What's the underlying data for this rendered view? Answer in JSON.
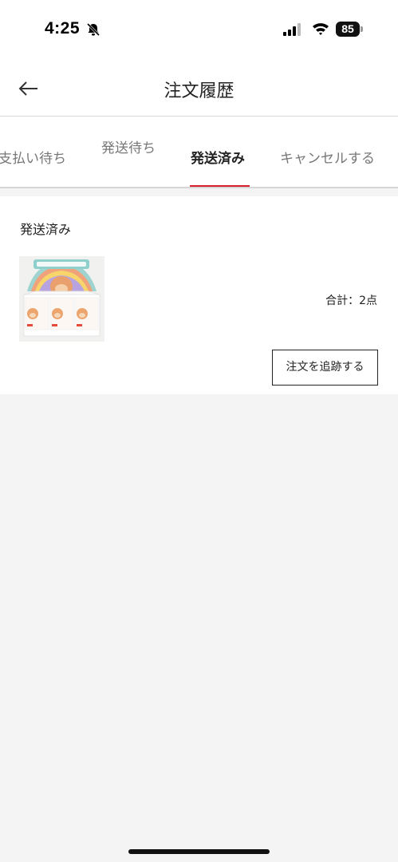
{
  "status_bar": {
    "time": "4:25",
    "battery": "85",
    "icons": [
      "bell-off-icon",
      "signal-icon",
      "wifi-icon",
      "battery-icon"
    ]
  },
  "nav": {
    "title": "注文履歴",
    "back_icon": "arrow-left-icon"
  },
  "tabs": [
    {
      "label": "支払い待ち",
      "active": false
    },
    {
      "label": "発送待ち",
      "active": false
    },
    {
      "label": "発送済み",
      "active": true
    },
    {
      "label": "キャンセルする",
      "active": false
    }
  ],
  "order": {
    "status": "発送済み",
    "total": "合計：2点",
    "track_button": "注文を追跡する"
  },
  "colors": {
    "accent": "#d8202b",
    "background": "#f4f4f4",
    "card": "#ffffff"
  }
}
